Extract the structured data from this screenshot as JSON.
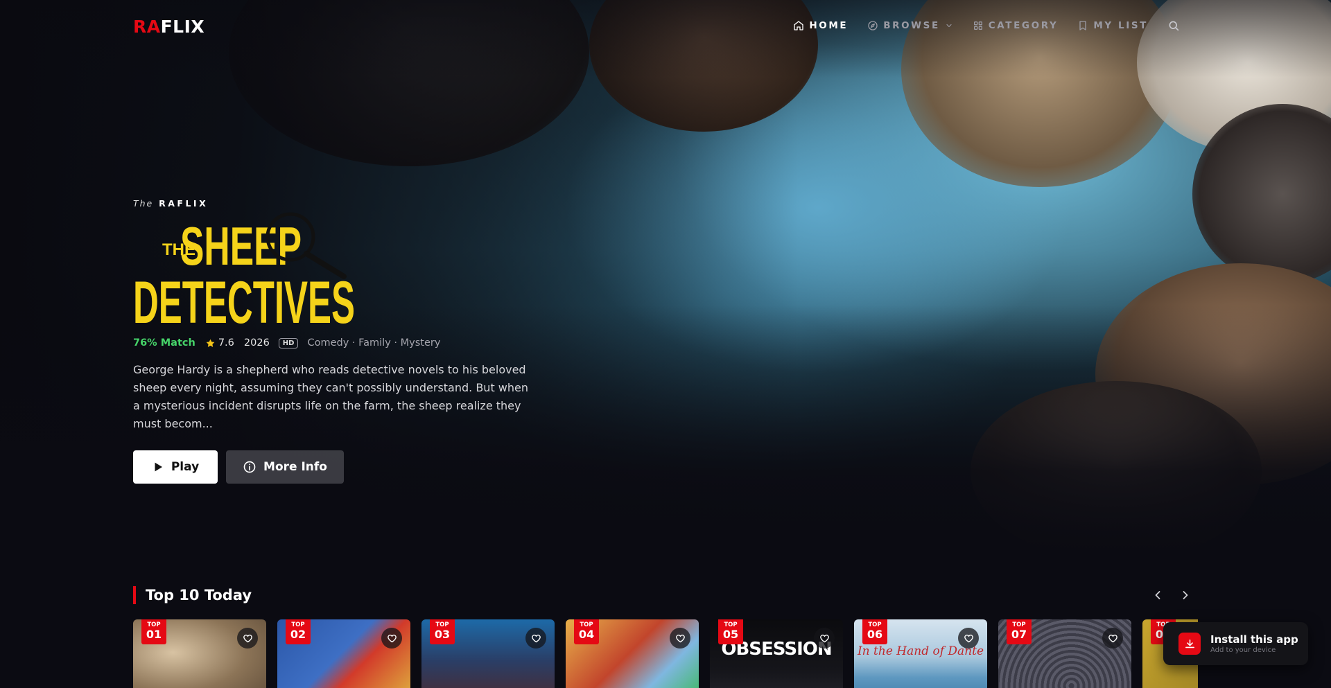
{
  "brand": {
    "logo_red": "RA",
    "logo_white": "FLIX",
    "accent": "#e50914"
  },
  "nav": {
    "items": [
      {
        "label": "HOME",
        "icon": "home-icon",
        "active": true
      },
      {
        "label": "BROWSE",
        "icon": "compass-icon",
        "active": false
      },
      {
        "label": "CATEGORY",
        "icon": "grid-icon",
        "active": false
      },
      {
        "label": "MY LIST",
        "icon": "bookmark-icon",
        "active": false
      }
    ],
    "search_icon": "search-icon"
  },
  "hero": {
    "eyebrow_prefix": "The",
    "eyebrow_brand": "RAFLIX",
    "title_line1_small": "THE",
    "title_line1": "SHEEP",
    "title_line2": "DETECTIVES",
    "match": "76% Match",
    "rating": "7.6",
    "year": "2026",
    "quality": "HD",
    "genres": "Comedy · Family · Mystery",
    "description": "George Hardy is a shepherd who reads detective novels to his beloved sheep every night, assuming they can't possibly understand. But when a mysterious incident disrupts life on the farm, the sheep realize they must becom...",
    "play_label": "Play",
    "info_label": "More Info",
    "match_color": "#46d369",
    "title_color": "#f5d31a"
  },
  "row": {
    "title": "Top 10 Today",
    "badge_label": "TOP",
    "cards": [
      {
        "rank": "01",
        "caption": "",
        "style": "sheep"
      },
      {
        "rank": "02",
        "caption": "",
        "style": "super"
      },
      {
        "rank": "03",
        "caption": "",
        "style": "crowd"
      },
      {
        "rank": "04",
        "caption": "",
        "style": "toy"
      },
      {
        "rank": "05",
        "caption": "OBSESSION",
        "style": "dark"
      },
      {
        "rank": "06",
        "caption": "In the Hand of Dante",
        "style": "sea"
      },
      {
        "rank": "07",
        "caption": "",
        "style": "spiral"
      },
      {
        "rank": "08",
        "caption": "",
        "style": "yellow"
      }
    ]
  },
  "install": {
    "title": "Install this app",
    "subtitle": "Add to your device"
  }
}
